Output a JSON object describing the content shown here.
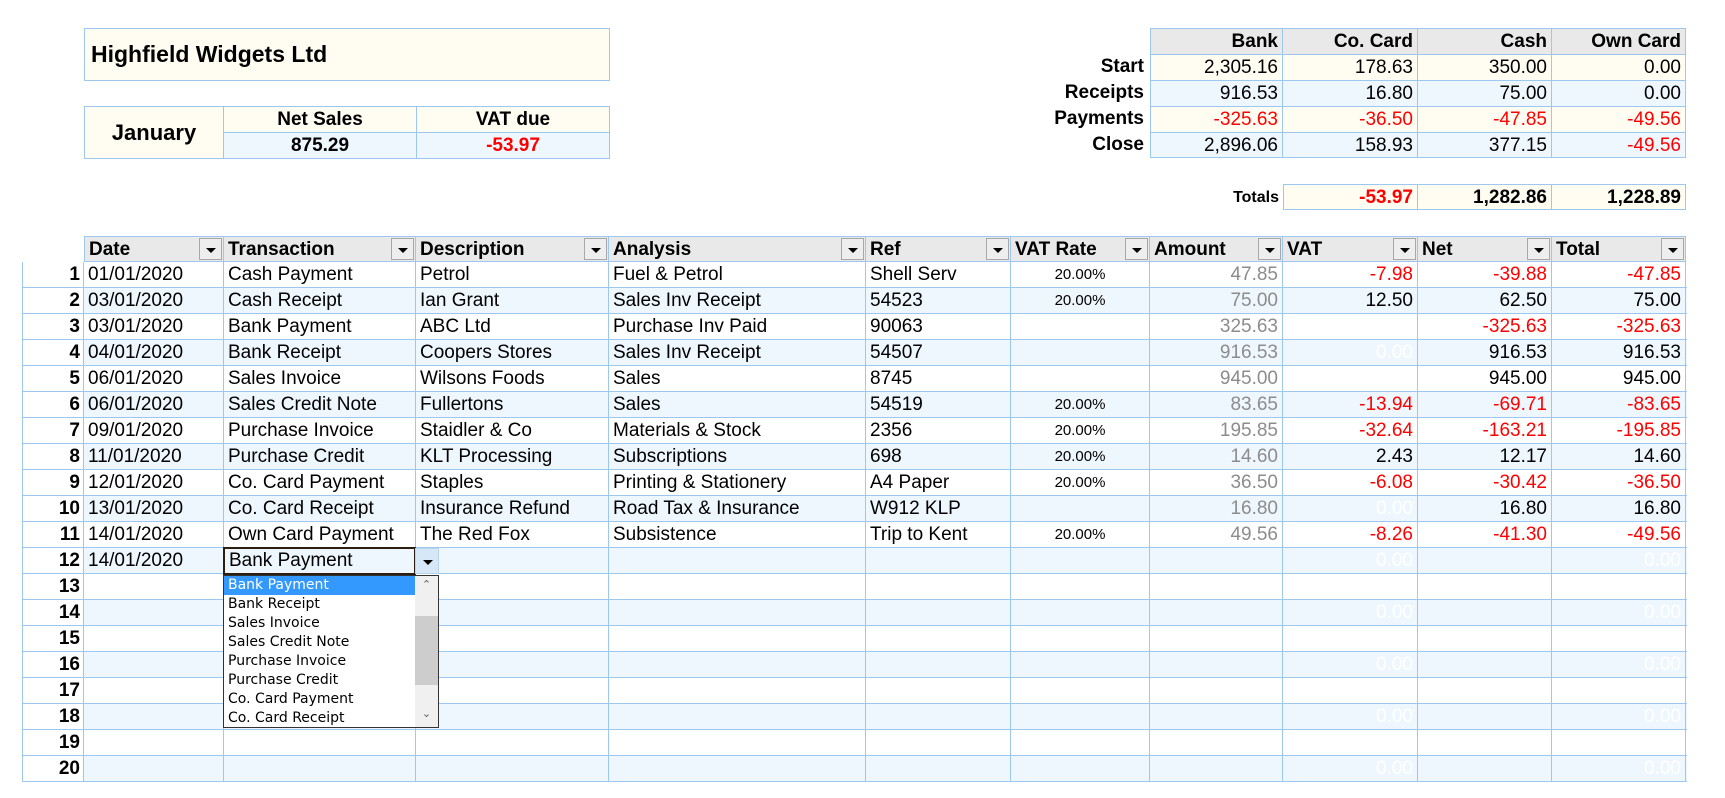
{
  "company": {
    "name": "Highfield Widgets Ltd"
  },
  "period": {
    "month": "January",
    "net_sales_label": "Net Sales",
    "net_sales": "875.29",
    "vat_due_label": "VAT due",
    "vat_due": "-53.97"
  },
  "accounts": {
    "columns": [
      "Bank",
      "Co. Card",
      "Cash",
      "Own Card"
    ],
    "rows": [
      {
        "label": "Start",
        "values": [
          "2,305.16",
          "178.63",
          "350.00",
          "0.00"
        ]
      },
      {
        "label": "Receipts",
        "values": [
          "916.53",
          "16.80",
          "75.00",
          "0.00"
        ]
      },
      {
        "label": "Payments",
        "values": [
          "-325.63",
          "-36.50",
          "-47.85",
          "-49.56"
        ]
      },
      {
        "label": "Close",
        "values": [
          "2,896.06",
          "158.93",
          "377.15",
          "-49.56"
        ]
      }
    ],
    "totals": {
      "label": "Totals",
      "values": [
        "-53.97",
        "1,282.86",
        "1,228.89"
      ]
    }
  },
  "table": {
    "headers": [
      "Date",
      "Transaction",
      "Description",
      "Analysis",
      "Ref",
      "VAT Rate",
      "Amount",
      "VAT",
      "Net",
      "Total"
    ],
    "rows": [
      {
        "n": "1",
        "date": "01/01/2020",
        "transaction": "Cash Payment",
        "description": "Petrol",
        "analysis": "Fuel & Petrol",
        "ref": "Shell Serv",
        "vat_rate": "20.00%",
        "amount": "47.85",
        "vat": "-7.98",
        "net": "-39.88",
        "total": "-47.85"
      },
      {
        "n": "2",
        "date": "03/01/2020",
        "transaction": "Cash Receipt",
        "description": "Ian Grant",
        "analysis": "Sales Inv Receipt",
        "ref": "54523",
        "vat_rate": "20.00%",
        "amount": "75.00",
        "vat": "12.50",
        "net": "62.50",
        "total": "75.00"
      },
      {
        "n": "3",
        "date": "03/01/2020",
        "transaction": "Bank Payment",
        "description": "ABC Ltd",
        "analysis": "Purchase Inv Paid",
        "ref": "90063",
        "vat_rate": "",
        "amount": "325.63",
        "vat": "",
        "net": "-325.63",
        "total": "-325.63"
      },
      {
        "n": "4",
        "date": "04/01/2020",
        "transaction": "Bank Receipt",
        "description": "Coopers Stores",
        "analysis": "Sales Inv Receipt",
        "ref": "54507",
        "vat_rate": "",
        "amount": "916.53",
        "vat": "0.00",
        "net": "916.53",
        "total": "916.53"
      },
      {
        "n": "5",
        "date": "06/01/2020",
        "transaction": "Sales Invoice",
        "description": "Wilsons Foods",
        "analysis": "Sales",
        "ref": "8745",
        "vat_rate": "",
        "amount": "945.00",
        "vat": "",
        "net": "945.00",
        "total": "945.00"
      },
      {
        "n": "6",
        "date": "06/01/2020",
        "transaction": "Sales Credit Note",
        "description": "Fullertons",
        "analysis": "Sales",
        "ref": "54519",
        "vat_rate": "20.00%",
        "amount": "83.65",
        "vat": "-13.94",
        "net": "-69.71",
        "total": "-83.65"
      },
      {
        "n": "7",
        "date": "09/01/2020",
        "transaction": "Purchase Invoice",
        "description": "Staidler & Co",
        "analysis": "Materials & Stock",
        "ref": "2356",
        "vat_rate": "20.00%",
        "amount": "195.85",
        "vat": "-32.64",
        "net": "-163.21",
        "total": "-195.85"
      },
      {
        "n": "8",
        "date": "11/01/2020",
        "transaction": "Purchase Credit",
        "description": "KLT Processing",
        "analysis": "Subscriptions",
        "ref": "698",
        "vat_rate": "20.00%",
        "amount": "14.60",
        "vat": "2.43",
        "net": "12.17",
        "total": "14.60"
      },
      {
        "n": "9",
        "date": "12/01/2020",
        "transaction": "Co. Card Payment",
        "description": "Staples",
        "analysis": "Printing & Stationery",
        "ref": "A4 Paper",
        "vat_rate": "20.00%",
        "amount": "36.50",
        "vat": "-6.08",
        "net": "-30.42",
        "total": "-36.50"
      },
      {
        "n": "10",
        "date": "13/01/2020",
        "transaction": "Co. Card Receipt",
        "description": "Insurance Refund",
        "analysis": "Road Tax & Insurance",
        "ref": "W912 KLP",
        "vat_rate": "",
        "amount": "16.80",
        "vat": "0.00",
        "net": "16.80",
        "total": "16.80"
      },
      {
        "n": "11",
        "date": "14/01/2020",
        "transaction": "Own Card Payment",
        "description": "The Red Fox",
        "analysis": "Subsistence",
        "ref": "Trip to Kent",
        "vat_rate": "20.00%",
        "amount": "49.56",
        "vat": "-8.26",
        "net": "-41.30",
        "total": "-49.56"
      },
      {
        "n": "12",
        "date": "14/01/2020",
        "transaction": "Bank Payment",
        "description": "",
        "analysis": "",
        "ref": "",
        "vat_rate": "",
        "amount": "",
        "vat": "0.00",
        "net": "",
        "total": "0.00"
      },
      {
        "n": "13",
        "date": "",
        "transaction": "",
        "description": "",
        "analysis": "",
        "ref": "",
        "vat_rate": "",
        "amount": "",
        "vat": "",
        "net": "",
        "total": ""
      },
      {
        "n": "14",
        "date": "",
        "transaction": "",
        "description": "",
        "analysis": "",
        "ref": "",
        "vat_rate": "",
        "amount": "",
        "vat": "0.00",
        "net": "",
        "total": "0.00"
      },
      {
        "n": "15",
        "date": "",
        "transaction": "",
        "description": "",
        "analysis": "",
        "ref": "",
        "vat_rate": "",
        "amount": "",
        "vat": "",
        "net": "",
        "total": ""
      },
      {
        "n": "16",
        "date": "",
        "transaction": "",
        "description": "",
        "analysis": "",
        "ref": "",
        "vat_rate": "",
        "amount": "",
        "vat": "0.00",
        "net": "",
        "total": "0.00"
      },
      {
        "n": "17",
        "date": "",
        "transaction": "",
        "description": "",
        "analysis": "",
        "ref": "",
        "vat_rate": "",
        "amount": "",
        "vat": "",
        "net": "",
        "total": ""
      },
      {
        "n": "18",
        "date": "",
        "transaction": "",
        "description": "",
        "analysis": "",
        "ref": "",
        "vat_rate": "",
        "amount": "",
        "vat": "0.00",
        "net": "",
        "total": "0.00"
      },
      {
        "n": "19",
        "date": "",
        "transaction": "",
        "description": "",
        "analysis": "",
        "ref": "",
        "vat_rate": "",
        "amount": "",
        "vat": "",
        "net": "",
        "total": ""
      },
      {
        "n": "20",
        "date": "",
        "transaction": "",
        "description": "",
        "analysis": "",
        "ref": "",
        "vat_rate": "",
        "amount": "",
        "vat": "0.00",
        "net": "",
        "total": "0.00"
      }
    ]
  },
  "dropdown": {
    "current_value": "Bank Payment",
    "options": [
      "Bank Payment",
      "Bank Receipt",
      "Sales Invoice",
      "Sales Credit Note",
      "Purchase Invoice",
      "Purchase Credit",
      "Co. Card Payment",
      "Co. Card Receipt"
    ],
    "selected_index": 0
  },
  "colors": {
    "negative": "#ff0000",
    "grid": "#9cc8f0",
    "cream_fill": "#fffdf2",
    "ice_fill": "#eef7fd",
    "selection": "#3399ff"
  }
}
